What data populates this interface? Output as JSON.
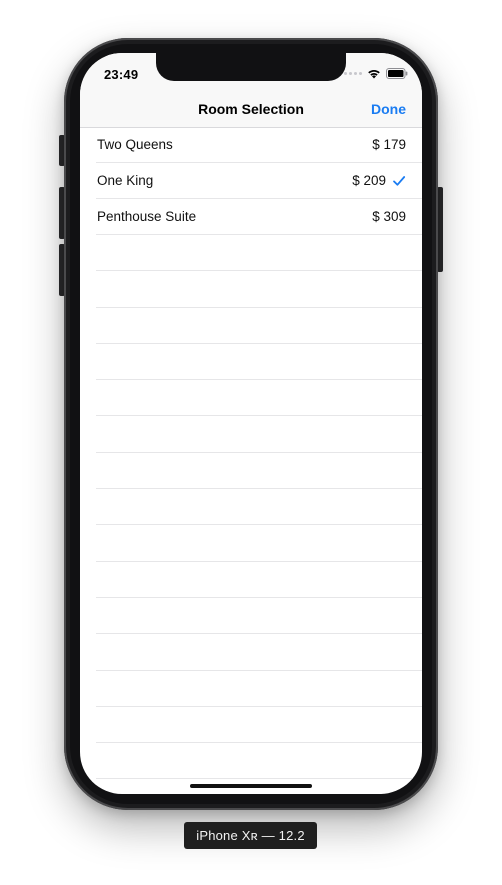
{
  "status_bar": {
    "time": "23:49"
  },
  "nav": {
    "title": "Room Selection",
    "done_label": "Done"
  },
  "rooms": [
    {
      "name": "Two Queens",
      "price": "$ 179",
      "selected": false
    },
    {
      "name": "One King",
      "price": "$ 209",
      "selected": true
    },
    {
      "name": "Penthouse Suite",
      "price": "$ 309",
      "selected": false
    }
  ],
  "device_label": "iPhone Xʀ — 12.2",
  "colors": {
    "accent": "#1a7cf2",
    "nav_background": "#f8f8f8",
    "separator": "#e6e6e8",
    "phone_frame": "#1c1c1e"
  },
  "icons": {
    "checkmark": "checkmark-icon",
    "wifi": "wifi-icon",
    "battery": "battery-icon",
    "signal": "signal-icon"
  }
}
